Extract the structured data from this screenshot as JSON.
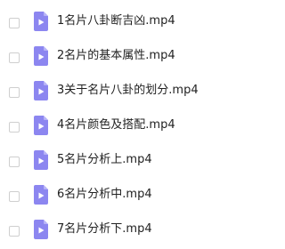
{
  "files": [
    {
      "name": "1名片八卦断吉凶.mp4",
      "icon": "video-file-icon"
    },
    {
      "name": "2名片的基本属性.mp4",
      "icon": "video-file-icon"
    },
    {
      "name": "3关于名片八卦的划分.mp4",
      "icon": "video-file-icon"
    },
    {
      "name": "4名片颜色及搭配.mp4",
      "icon": "video-file-icon"
    },
    {
      "name": "5名片分析上.mp4",
      "icon": "video-file-icon"
    },
    {
      "name": "6名片分析中.mp4",
      "icon": "video-file-icon"
    },
    {
      "name": "7名片分析下.mp4",
      "icon": "video-file-icon"
    }
  ],
  "colors": {
    "icon_fill": "#8c86f0",
    "icon_fold": "#b7b3f7",
    "icon_play": "#ffffff",
    "checkbox_border": "#cfcfcf",
    "text": "#222222"
  }
}
